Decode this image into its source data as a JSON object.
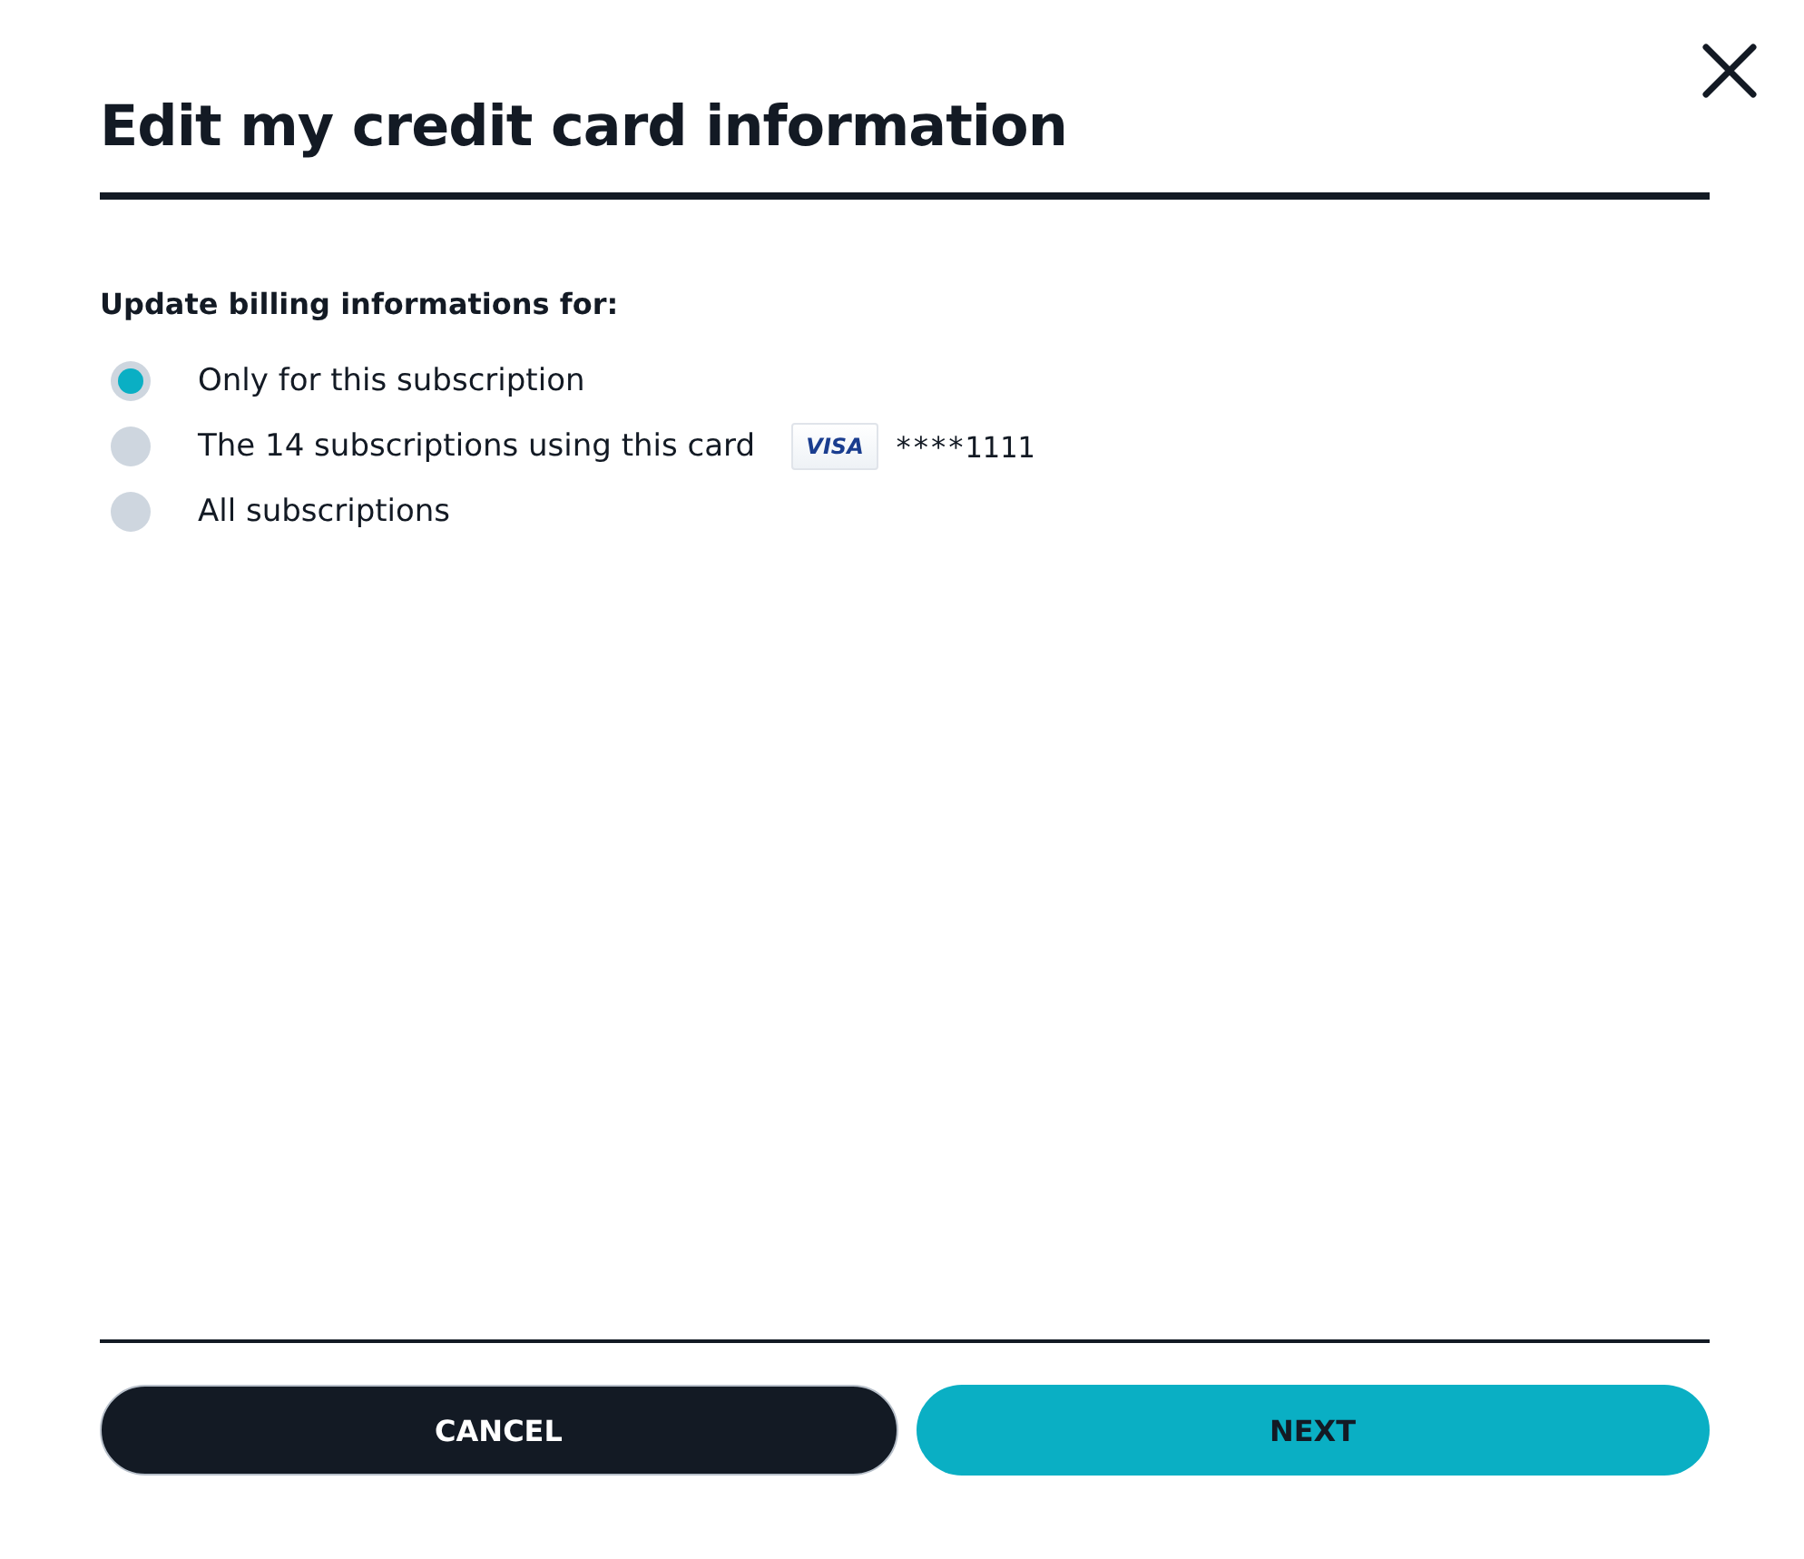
{
  "dialog": {
    "title": "Edit my credit card information"
  },
  "prompt": "Update billing informations for:",
  "options": [
    {
      "label": "Only for this subscription",
      "selected": true
    },
    {
      "label": "The 14 subscriptions using this card",
      "selected": false,
      "card": {
        "brand": "VISA",
        "number": "****1111"
      }
    },
    {
      "label": "All subscriptions",
      "selected": false
    }
  ],
  "buttons": [
    {
      "label": "CANCEL",
      "kind": "secondary"
    },
    {
      "label": "NEXT",
      "kind": "primary"
    }
  ]
}
